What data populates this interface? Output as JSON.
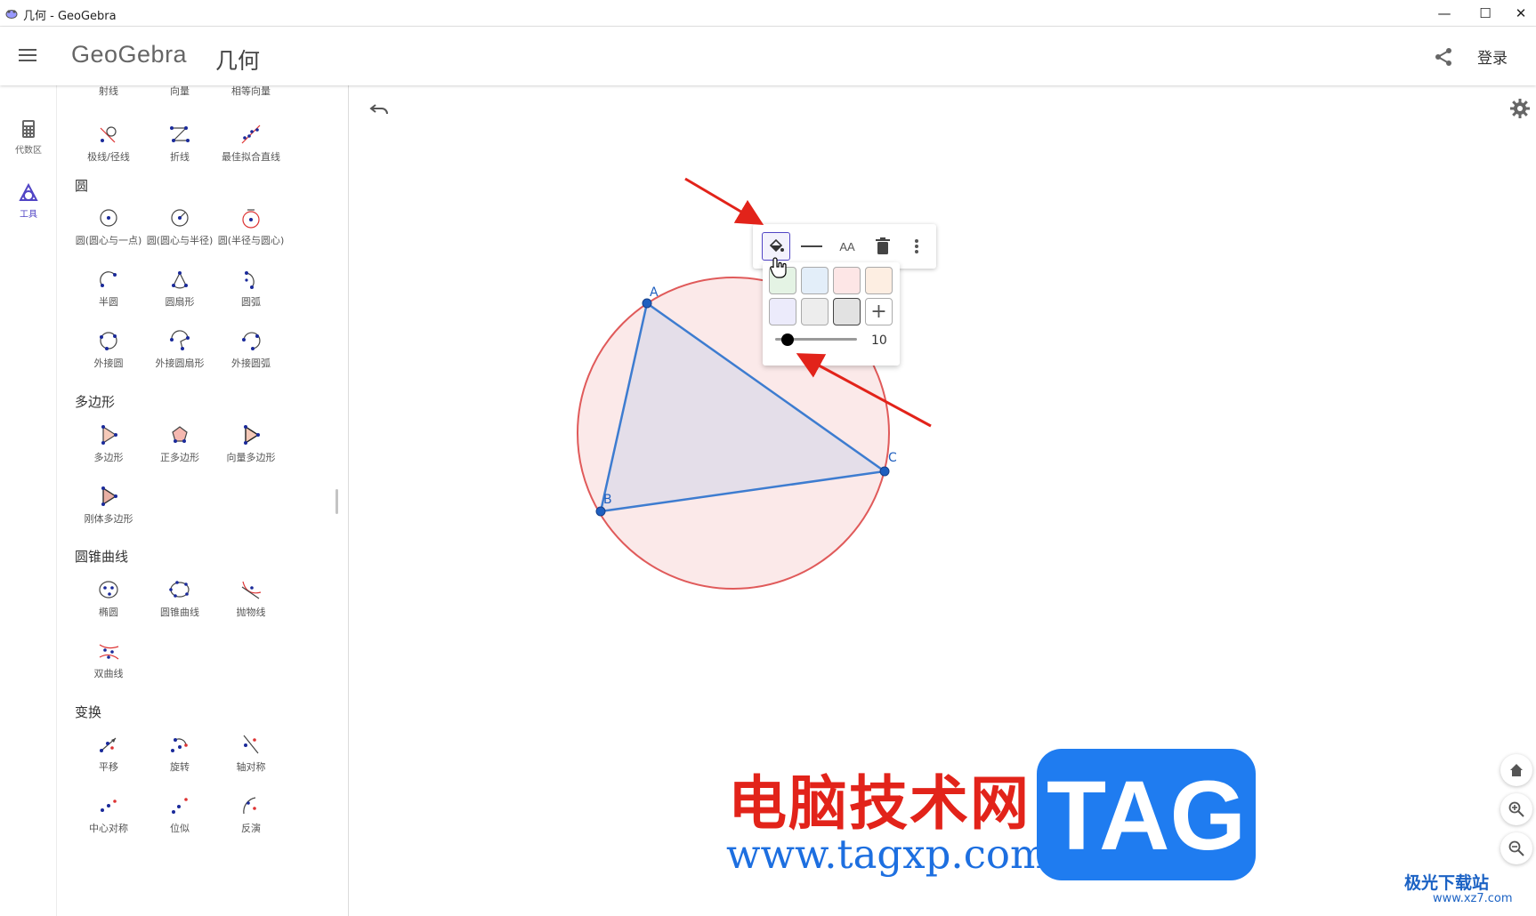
{
  "window": {
    "title": "几何 - GeoGebra",
    "minimize": "—",
    "maximize": "☐",
    "close": "✕"
  },
  "header": {
    "logo": "GeoGebra",
    "app_name": "几何",
    "login": "登录"
  },
  "rail": {
    "items": [
      {
        "label": "代数区",
        "icon": "calculator-icon"
      },
      {
        "label": "工具",
        "icon": "geometry-tools-icon"
      }
    ]
  },
  "tools": {
    "partial_row": [
      "射线",
      "向量",
      "相等向量"
    ],
    "lines_row": [
      "极线/径线",
      "折线",
      "最佳拟合直线"
    ],
    "sections": [
      {
        "title": "圆",
        "items": [
          "圆(圆心与一点)",
          "圆(圆心与半径)",
          "圆(半径与圆心)",
          "半圆",
          "圆扇形",
          "圆弧",
          "外接圆",
          "外接圆扇形",
          "外接圆弧"
        ]
      },
      {
        "title": "多边形",
        "items": [
          "多边形",
          "正多边形",
          "向量多边形",
          "刚体多边形"
        ]
      },
      {
        "title": "圆锥曲线",
        "items": [
          "椭圆",
          "圆锥曲线",
          "抛物线",
          "双曲线"
        ]
      },
      {
        "title": "变换",
        "items": [
          "平移",
          "旋转",
          "轴对称",
          "中心对称",
          "位似",
          "反演"
        ]
      }
    ]
  },
  "canvas": {
    "points": [
      {
        "label": "A"
      },
      {
        "label": "B"
      },
      {
        "label": "C"
      }
    ],
    "circle_fill": "#fbe9e9",
    "circle_stroke": "#e05a5a",
    "triangle_fill": "#e4dee9",
    "triangle_stroke": "#3d7cd0"
  },
  "stylebar": {
    "buttons": [
      {
        "icon": "fill-color-icon"
      },
      {
        "icon": "line-style-icon"
      },
      {
        "icon": "text-size-icon",
        "label": "AA"
      },
      {
        "icon": "delete-icon"
      },
      {
        "icon": "more-vertical-icon"
      }
    ],
    "swatches": [
      "#e4f3e4",
      "#e3eef9",
      "#fde6e6",
      "#fdeee2",
      "#ecebfb",
      "#ededed",
      "#e2e2e2"
    ],
    "add_label": "+",
    "opacity": "10"
  },
  "watermark": {
    "cn": "电脑技术网",
    "url": "www.tagxp.com",
    "tag": "TAG",
    "corner": "极光下载站",
    "corner_url": "www.xz7.com"
  }
}
